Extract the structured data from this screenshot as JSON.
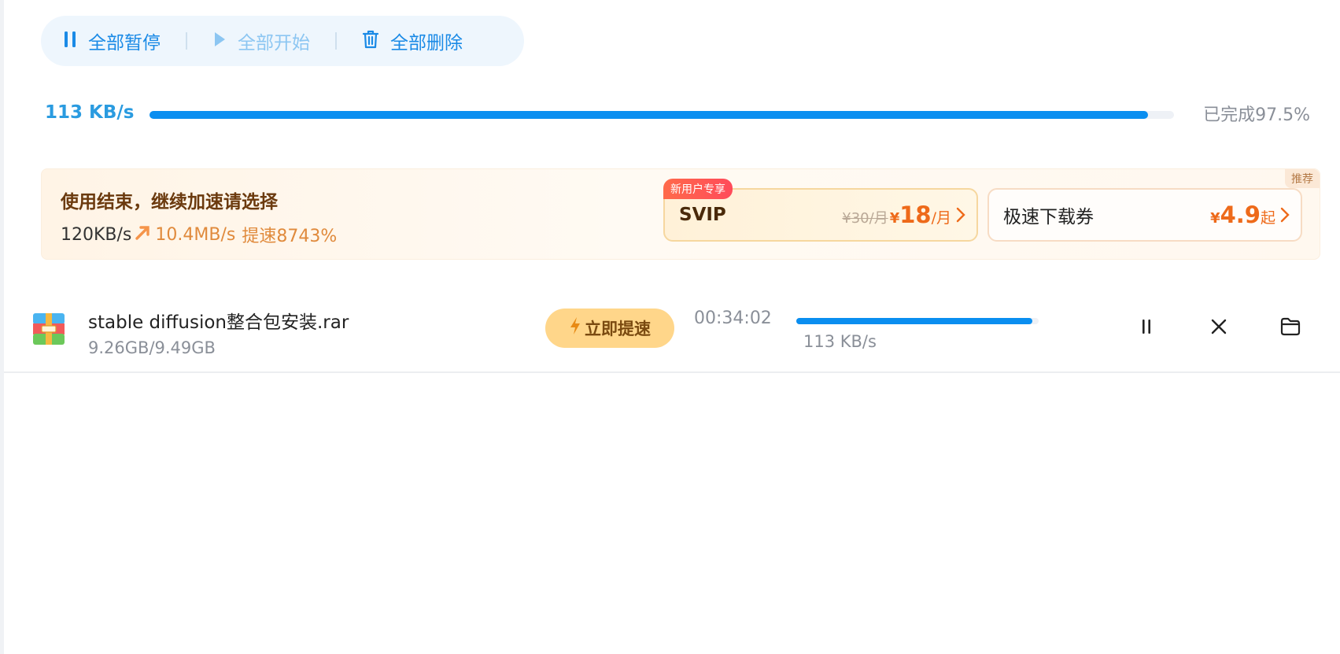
{
  "toolbar": {
    "pause_all": "全部暂停",
    "start_all": "全部开始",
    "delete_all": "全部删除"
  },
  "overall": {
    "speed": "113 KB/s",
    "completed": "已完成97.5%",
    "progress": 0.975
  },
  "promo": {
    "title": "使用结束，继续加速请选择",
    "old_speed": "120KB/s",
    "new_speed": "10.4MB/s",
    "boost_pct": "提速8743%",
    "recommend": "推荐",
    "svip": {
      "badge": "新用户专享",
      "name": "SVIP",
      "old_price": "¥30/月",
      "yen": "¥",
      "price": "18",
      "unit": "/月"
    },
    "ticket": {
      "name": "极速下载券",
      "yen": "¥",
      "price": "4.9",
      "unit": "起"
    }
  },
  "task": {
    "filename": "stable diffusion整合包安装.rar",
    "size": "9.26GB/9.49GB",
    "boost_label": "立即提速",
    "time_left": "00:34:02",
    "speed": "113 KB/s",
    "progress": 0.975
  },
  "colors": {
    "accent": "#0a8ef0",
    "promo_orange": "#ee6a1a"
  }
}
